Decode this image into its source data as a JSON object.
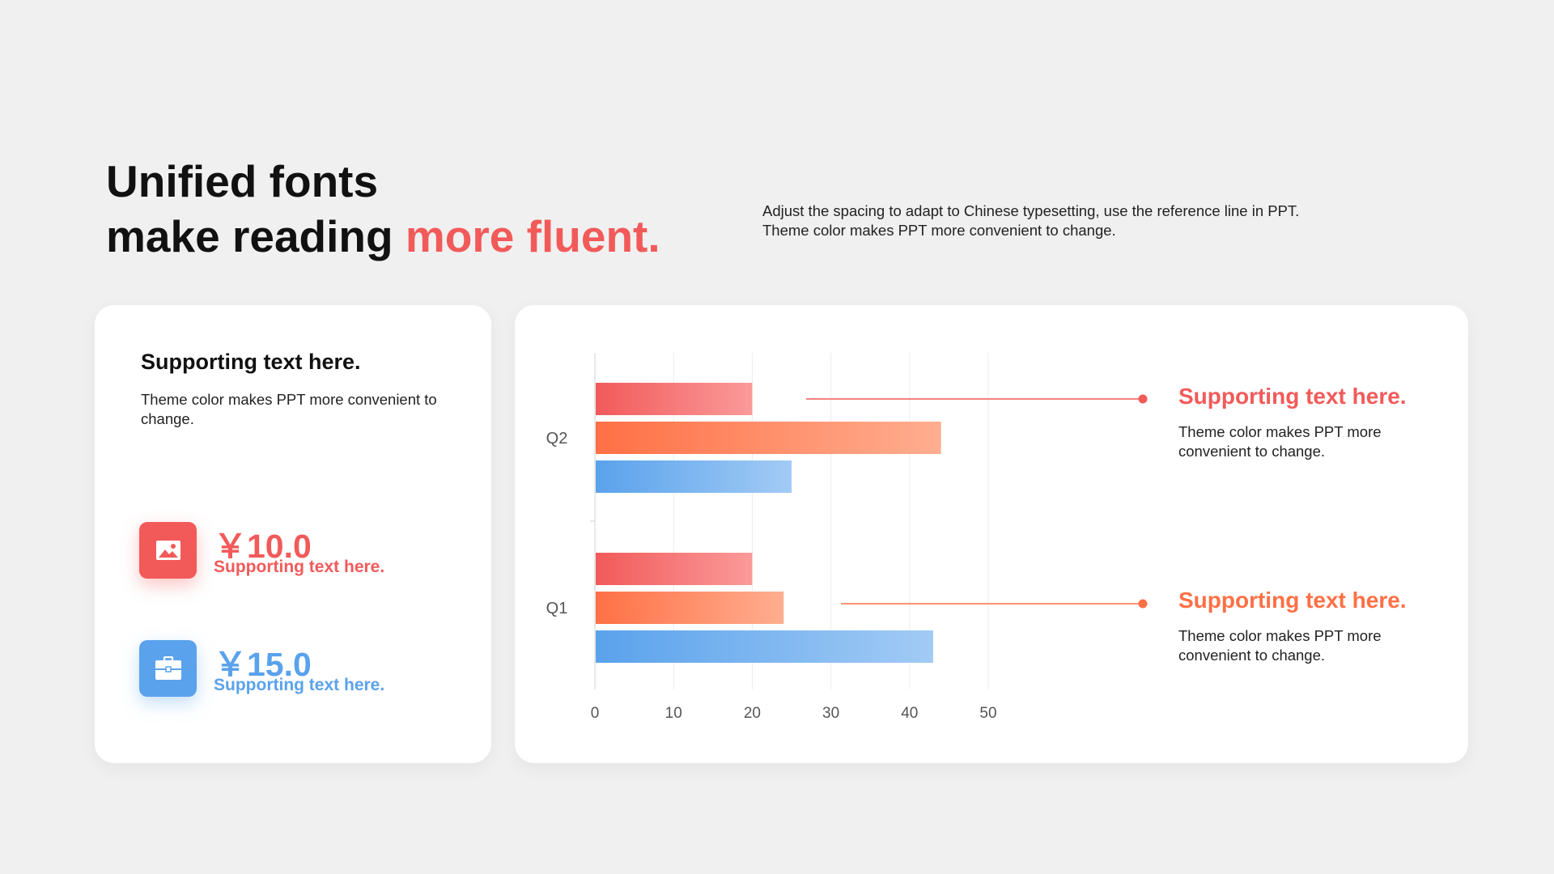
{
  "headline": {
    "line1": "Unified fonts",
    "line2_prefix": "make reading ",
    "line2_accent": "more fluent."
  },
  "intro": {
    "line1": "Adjust the spacing to adapt to Chinese typesetting, use the reference line in PPT.",
    "line2": "Theme color makes PPT more convenient to change."
  },
  "left_card": {
    "title": "Supporting text here.",
    "description": "Theme color makes PPT more convenient to change.",
    "stats": [
      {
        "value": "￥10.0",
        "label": "Supporting text here.",
        "icon": "image-icon",
        "color": "#f25a5a"
      },
      {
        "value": "￥15.0",
        "label": "Supporting text here.",
        "icon": "briefcase-icon",
        "color": "#5aa2ec"
      }
    ]
  },
  "annotations": [
    {
      "title": "Supporting text here.",
      "description": "Theme color makes PPT more convenient to change.",
      "color": "#f25a5a"
    },
    {
      "title": "Supporting text here.",
      "description": "Theme color makes PPT more convenient to change.",
      "color": "#ff7045"
    }
  ],
  "chart_data": {
    "type": "bar",
    "orientation": "horizontal",
    "categories": [
      "Q2",
      "Q1"
    ],
    "series": [
      {
        "values": [
          20,
          20
        ],
        "gradient": [
          "#f25a5a",
          "#fb9a9a"
        ]
      },
      {
        "values": [
          44,
          24
        ],
        "gradient": [
          "#ff7045",
          "#ffae90"
        ]
      },
      {
        "values": [
          25,
          43
        ],
        "gradient": [
          "#5aa2ec",
          "#a2cbf5"
        ]
      }
    ],
    "xticks": [
      0,
      10,
      20,
      30,
      40,
      50
    ],
    "xlim": [
      0,
      50
    ],
    "grid": true,
    "title": "",
    "xlabel": "",
    "ylabel": ""
  }
}
